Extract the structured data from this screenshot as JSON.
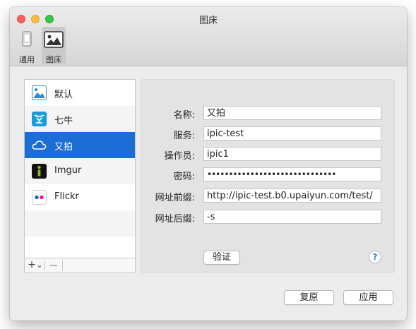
{
  "window": {
    "title": "图床"
  },
  "toolbar": {
    "items": [
      {
        "label": "通用",
        "icon": "phone-icon",
        "selected": false
      },
      {
        "label": "图床",
        "icon": "image-icon",
        "selected": true
      }
    ]
  },
  "services": {
    "items": [
      {
        "label": "默认",
        "icon": "default-image-icon",
        "selected": false
      },
      {
        "label": "七牛",
        "icon": "qiniu-icon",
        "selected": false
      },
      {
        "label": "又拍",
        "icon": "upyun-cloud-icon",
        "selected": true
      },
      {
        "label": "Imgur",
        "icon": "imgur-icon",
        "selected": false
      },
      {
        "label": "Flickr",
        "icon": "flickr-icon",
        "selected": false
      }
    ],
    "add_label": "+",
    "add_menu_label": "⌄",
    "remove_label": "—"
  },
  "form": {
    "name_label": "名称:",
    "name_value": "又拍",
    "service_label": "服务:",
    "service_value": "ipic-test",
    "operator_label": "操作员:",
    "operator_value": "ipic1",
    "password_label": "密码:",
    "password_value": "••••••••••••••••••••••••••••••",
    "url_prefix_label": "网址前缀:",
    "url_prefix_value": "http://ipic-test.b0.upaiyun.com/test/",
    "url_suffix_label": "网址后缀:",
    "url_suffix_value": "-s",
    "verify_label": "验证",
    "help_label": "?"
  },
  "footer": {
    "revert_label": "复原",
    "apply_label": "应用"
  },
  "colors": {
    "selection": "#1d6dd6",
    "accent": "#2a7ce0"
  }
}
